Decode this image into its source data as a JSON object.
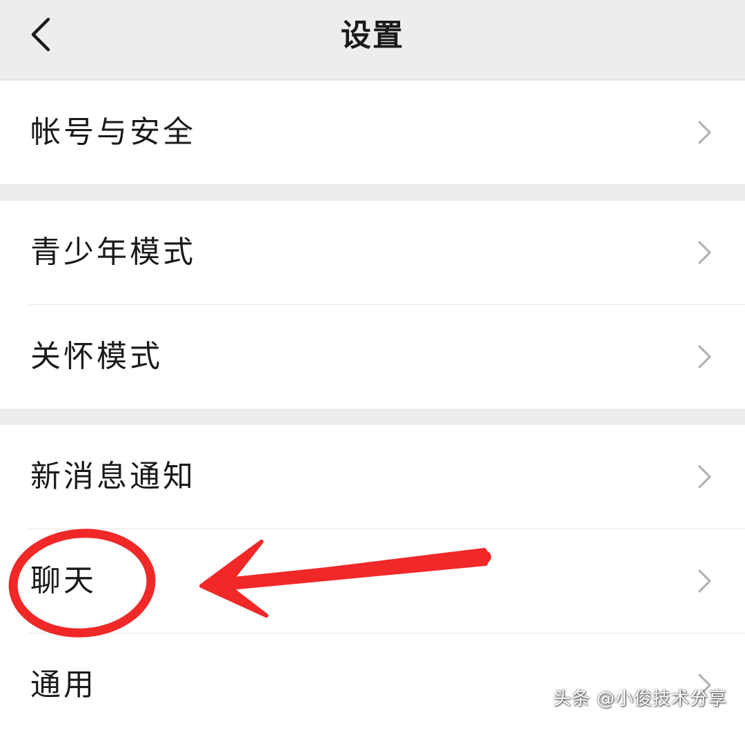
{
  "navbar": {
    "title": "设置",
    "back_icon": "chevron-left-icon"
  },
  "groups": [
    {
      "items": [
        {
          "label": "帐号与安全"
        }
      ]
    },
    {
      "items": [
        {
          "label": "青少年模式"
        },
        {
          "label": "关怀模式"
        }
      ]
    },
    {
      "items": [
        {
          "label": "新消息通知"
        },
        {
          "label": "聊天"
        },
        {
          "label": "通用"
        }
      ]
    }
  ],
  "annotation": {
    "color": "#f02828",
    "highlighted_item": "聊天"
  },
  "watermark": "头条 @小俊技术分享",
  "colors": {
    "background": "#ededed",
    "cell": "#ffffff",
    "text": "#1a1a1a",
    "chevron": "#b2b2b2"
  }
}
